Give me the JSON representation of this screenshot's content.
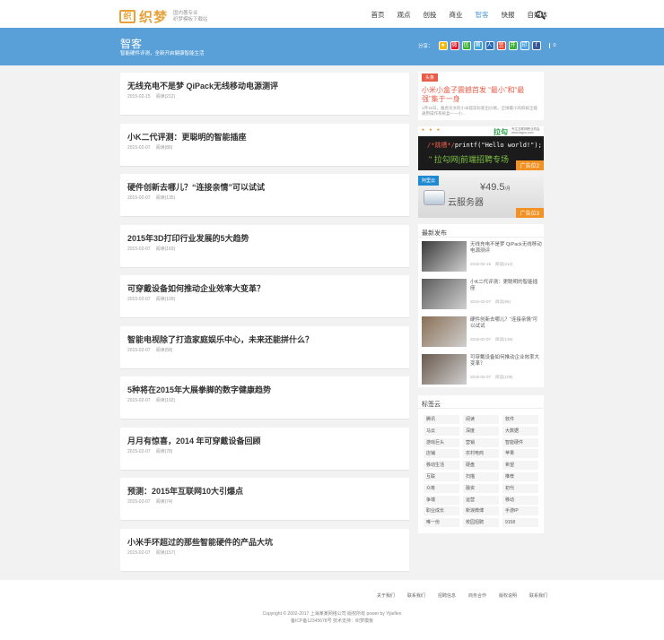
{
  "header": {
    "logo_mark": "织",
    "logo_text": "织梦",
    "slogan_line1": "国内著专业",
    "slogan_line2": "织梦模板下载站",
    "nav": [
      "首页",
      "观点",
      "创投",
      "商业",
      "智客",
      "快报",
      "自媒体"
    ]
  },
  "banner": {
    "title": "智客",
    "desc": "智能硬件评测，全新开启健康智能生活",
    "share_label": "分享：",
    "share_count": "0",
    "share_buttons": [
      {
        "icon": "qzone-icon",
        "glyph": "★",
        "color": "#f5b800"
      },
      {
        "icon": "weibo-icon",
        "glyph": "微",
        "color": "#e6162d"
      },
      {
        "icon": "wechat-icon",
        "glyph": "信",
        "color": "#3cb034"
      },
      {
        "icon": "tencent-weibo-icon",
        "glyph": "腾",
        "color": "#37a3d9"
      },
      {
        "icon": "renren-icon",
        "glyph": "人",
        "color": "#2d6cb5"
      },
      {
        "icon": "douban-icon",
        "glyph": "豆",
        "color": "#e94b3c"
      },
      {
        "icon": "kaixin-icon",
        "glyph": "开",
        "color": "#3cb034"
      },
      {
        "icon": "print-icon",
        "glyph": "印",
        "color": "#47a3e6"
      },
      {
        "icon": "facebook-icon",
        "glyph": "f",
        "color": "#3b5998"
      }
    ]
  },
  "articles": [
    {
      "title": "无线充电不是梦 QiPack无线移动电源测评",
      "date": "2015-02-15",
      "views": "阅读(212)"
    },
    {
      "title": "小K二代评测：更聪明的智能插座",
      "date": "2015-02-07",
      "views": "阅读(86)"
    },
    {
      "title": "硬件创新去哪儿？“连接亲情”可以试试",
      "date": "2015-02-07",
      "views": "阅读(135)"
    },
    {
      "title": "2015年3D打印行业发展的5大趋势",
      "date": "2015-02-07",
      "views": "阅读(169)"
    },
    {
      "title": "可穿戴设备如何推动企业效率大变革？",
      "date": "2015-02-07",
      "views": "阅读(109)"
    },
    {
      "title": "智能电视除了打造家庭娱乐中心，未来还能拼什么？",
      "date": "2015-02-07",
      "views": "阅读(58)"
    },
    {
      "title": "5种将在2015年大展拳脚的数字健康趋势",
      "date": "2015-02-07",
      "views": "阅读(192)"
    },
    {
      "title": "月月有惊喜，2014 年可穿戴设备回顾",
      "date": "2015-02-07",
      "views": "阅读(78)"
    },
    {
      "title": "预测：2015年互联网10大引爆点",
      "date": "2015-02-07",
      "views": "阅读(74)"
    },
    {
      "title": "小米手环超过的那些智能硬件的产品大坑",
      "date": "2015-02-07",
      "views": "阅读(157)"
    }
  ],
  "headline": {
    "tag": "头条",
    "title": "小米小盒子震撼首发 “最小”和“最强”集于一身",
    "excerpt": "1月15日，雅虎天文的小米提前标新出价格，全球最小的四核全能通用操作系统盒——小..."
  },
  "ad2": {
    "brand": "拉勾",
    "brand_sub": "专注互联网职业机会",
    "brand_url": "www.lagou.com",
    "code_highlight": "/*跳槽*/",
    "code_text": "printf(\"Hello world!\");",
    "slogan": "拉勾网|前端招聘专场",
    "label": "广告位2"
  },
  "ad3": {
    "brand": "阿里云",
    "price": "¥49.5",
    "price_unit": "/月",
    "product": "云服务器",
    "label": "广告位3"
  },
  "recent": {
    "title": "最新发布",
    "items": [
      {
        "title": "无线充电不是梦 QiPack无线移动电源测评",
        "date": "2015-02-15",
        "views": "阅读(212)"
      },
      {
        "title": "小K二代评测：更聪明的智能插座",
        "date": "2015-02-07",
        "views": "阅读(86)"
      },
      {
        "title": "硬件创新去哪儿？“连接亲情”可以试试",
        "date": "2015-02-07",
        "views": "阅读(135)"
      },
      {
        "title": "可穿戴设备如何推动企业效率大变革？",
        "date": "2015-02-07",
        "views": "阅读(109)"
      }
    ]
  },
  "tagcloud": {
    "title": "标签云",
    "tags": [
      "腾讯",
      "阅读",
      "软件",
      "马云",
      "深度",
      "大数据",
      "游戏巨头",
      "营销",
      "智能硬件",
      "店铺",
      "农村电商",
      "苹果",
      "移动生活",
      "硬盘",
      "希望",
      "互联",
      "扫描",
      "推荐",
      "众筹",
      "融资",
      "初代",
      "争端",
      "运营",
      "移动",
      "职业成长",
      "新浪微博",
      "手游IP",
      "唯一份",
      "校园招聘",
      "9158"
    ]
  },
  "footer": {
    "links": [
      "关于我们",
      "联系我们",
      "招聘信息",
      "商务合作",
      "版权说明",
      "联系我们"
    ],
    "copyright": "Copyright © 2002-2017 上海某某网络公司 版权所有 power by Yijieflen",
    "icp": "备ICP备12345678号  技术支持：织梦模板"
  }
}
